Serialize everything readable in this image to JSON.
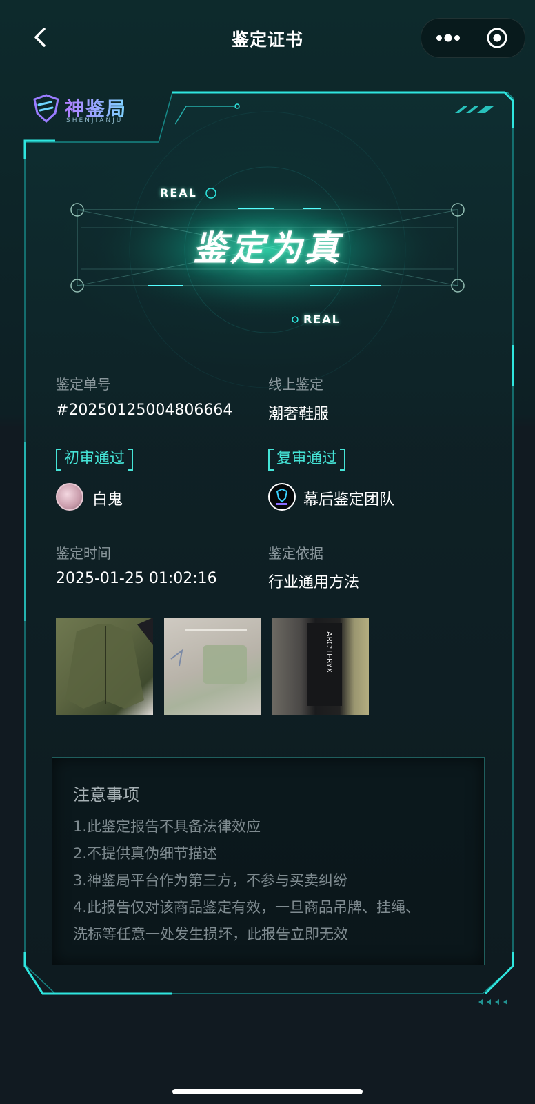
{
  "nav": {
    "title": "鉴定证书"
  },
  "brand": {
    "name": "神鉴局",
    "subtitle": "SHENJIANJU"
  },
  "hero": {
    "result": "鉴定为真",
    "tag_top": "REAL",
    "tag_bottom": "REAL"
  },
  "info": {
    "order_label": "鉴定单号",
    "order_value": "#20250125004806664",
    "type_label": "线上鉴定",
    "type_value": "潮奢鞋服",
    "first_review": "初审通过",
    "first_reviewer": "白鬼",
    "second_review": "复审通过",
    "second_reviewer": "幕后鉴定团队",
    "time_label": "鉴定时间",
    "time_value": "2025-01-25 01:02:16",
    "basis_label": "鉴定依据",
    "basis_value": "行业通用方法"
  },
  "photos": [
    {
      "icon": "jacket-photo"
    },
    {
      "icon": "inner-lining-photo"
    },
    {
      "icon": "label-photo",
      "label_text": "ARC'TERYX"
    }
  ],
  "notice": {
    "title": "注意事项",
    "lines": [
      "1.此鉴定报告不具备法律效应",
      "2.不提供真伪细节描述",
      "3.神鉴局平台作为第三方，不参与买卖纠纷",
      "4.此报告仅对该商品鉴定有效，一旦商品吊牌、挂绳、",
      "洗标等任意一处发生损坏，此报告立即无效"
    ]
  },
  "colors": {
    "accent": "#45e3d6",
    "frame": "#1fd6d0",
    "background": "#111a21"
  }
}
